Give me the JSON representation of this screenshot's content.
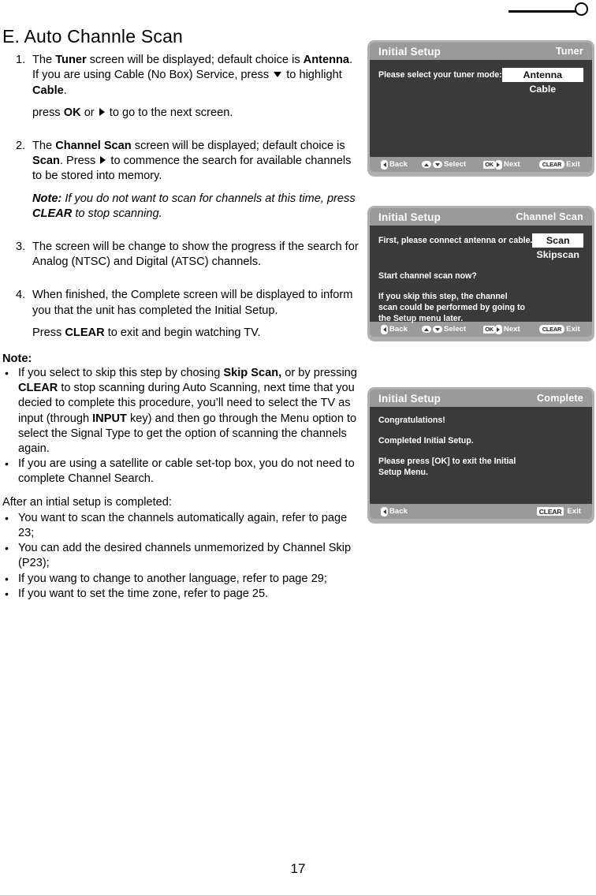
{
  "page": {
    "number": "17",
    "title": "E. Auto Channle Scan"
  },
  "steps": [
    {
      "num": "1.",
      "text_a": "The ",
      "bold_a": "Tuner",
      "text_b": " screen will be displayed; default choice is ",
      "bold_b": "Antenna",
      "text_c": ". If you are using Cable (No Box) Service, press ",
      "icon_down": "down-triangle-icon",
      "text_d": " to highlight ",
      "bold_c": "Cable",
      "text_e": ".",
      "sub_a": "press ",
      "sub_bold": "OK",
      "sub_b": " or ",
      "icon_right": "right-triangle-icon",
      "sub_c": " to go to the next screen."
    },
    {
      "num": "2.",
      "text_a": "The ",
      "bold_a": "Channel Scan",
      "text_b": " screen will be displayed; default choice is ",
      "bold_b": "Scan",
      "text_c": ". Press ",
      "icon_right": "right-triangle-icon",
      "text_d": " to commence the search for available channels to be stored into memory.",
      "note_label": "Note:",
      "note_a": " If you do not want to scan for channels at this time, press ",
      "note_bold": "CLEAR",
      "note_b": " to stop scanning."
    },
    {
      "num": "3.",
      "text_a": "The screen will be change to show the progress if the search for Analog (NTSC) and Digital (ATSC) channels."
    },
    {
      "num": "4.",
      "text_a": "When finished, the Complete screen will be displayed to inform you  that the unit has completed the Initial Setup.",
      "sub_a": "Press ",
      "sub_bold": "CLEAR",
      "sub_b": " to exit and begin watching TV."
    }
  ],
  "note_section": {
    "heading": "Note:",
    "bullets": [
      {
        "a": "If you select to skip this step by chosing ",
        "b1": "Skip Scan,",
        "b": " or by pressing ",
        "b2": "CLEAR",
        "c": " to stop scanning during Auto Scanning, next time that you decied to complete this procedure, you’ll need to select the TV as input (through ",
        "b3": "INPUT",
        "d": " key) and then go through the Menu option to select the Signal Type to get the option of scanning the channels again."
      },
      {
        "a": "If you are using a satellite or cable set-top box, you do not need to complete Channel Search."
      }
    ]
  },
  "after_section": {
    "intro": "After an intial setup is completed:",
    "bullets": [
      "You want to scan the channels automatically again, refer to page 23;",
      "You can add the desired channels unmemorized by Channel Skip (P23);",
      "If you wang to change to another language, refer to page 29;",
      "If you want to set the time zone, refer to page 25."
    ]
  },
  "tv_screens": [
    {
      "title": "Initial Setup",
      "screen_name": "Tuner",
      "prompt": "Please select your tuner mode:",
      "option_selected": "Antenna",
      "option_other": "Cable",
      "footer": [
        {
          "icon": "left-arrow-key-icon",
          "label": "Back"
        },
        {
          "icon": "up-down-arrow-keys-icon",
          "label": "Select"
        },
        {
          "icon": "ok-right-arrow-key-icon",
          "label": "Next"
        },
        {
          "icon": "clear-key-icon",
          "label": "Exit",
          "key": "CLEAR"
        }
      ]
    },
    {
      "title": "Initial Setup",
      "screen_name": "Channel Scan",
      "prompt": "First, please connect antenna or cable.",
      "option_selected": "Scan",
      "option_other": "Skipscan",
      "line1": "Start channel scan now?",
      "line2": "If you skip this step, the channel",
      "line3": "scan could be performed by going to",
      "line4": "the Setup menu later.",
      "footer": [
        {
          "icon": "left-arrow-key-icon",
          "label": "Back"
        },
        {
          "icon": "up-down-arrow-keys-icon",
          "label": "Select"
        },
        {
          "icon": "ok-right-arrow-key-icon",
          "label": "Next"
        },
        {
          "icon": "clear-key-icon",
          "label": "Exit",
          "key": "CLEAR"
        }
      ]
    },
    {
      "title": "Initial Setup",
      "screen_name": "Complete",
      "line1": "Congratulations!",
      "line2": "Completed Initial Setup.",
      "line3": "Please press [OK] to exit the Initial",
      "line4": "Setup Menu.",
      "footer": [
        {
          "icon": "left-arrow-key-icon",
          "label": "Back"
        },
        {
          "icon": "clear-key-icon",
          "label": "Exit",
          "key": "CLEAR"
        }
      ]
    }
  ],
  "colors": {
    "panel_frame": "#b0b0b0",
    "panel_header": "#9a9a9a",
    "panel_body": "#3a3a3a",
    "highlight_bg": "#ffffff",
    "text_on_dark": "#ffffff"
  }
}
